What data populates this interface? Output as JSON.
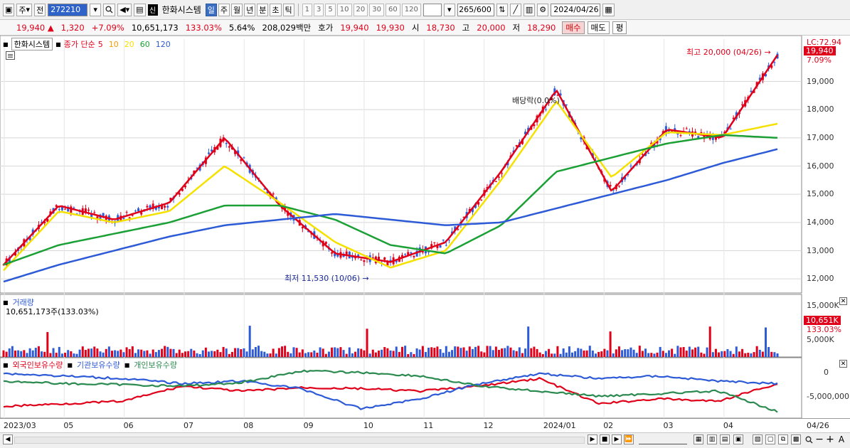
{
  "toolbar": {
    "period_select": "주",
    "prev_label": "전",
    "code": "272210",
    "badge": "신",
    "stock_name": "한화시스템",
    "periods": [
      "일",
      "주",
      "월",
      "년",
      "분",
      "초",
      "틱"
    ],
    "active_period": "일",
    "nums": [
      "1",
      "3",
      "5",
      "10",
      "20",
      "30",
      "60",
      "120"
    ],
    "count": "265",
    "count_total": "/600",
    "date": "2024/04/26"
  },
  "quote": {
    "price": "19,940",
    "change": "1,320",
    "change_pct": "+7.09%",
    "volume": "10,651,173",
    "vol_ratio": "133.03%",
    "turnover": "5.64%",
    "amount": "208,029백만",
    "bid_label": "호가",
    "ask_price": "19,940",
    "bid_price": "19,930",
    "open_label": "시",
    "open": "18,730",
    "high_label": "고",
    "high": "20,000",
    "low_label": "저",
    "low": "18,290",
    "buy": "매수",
    "sell": "매도",
    "eval": "평"
  },
  "legend": {
    "stock": "한화시스템",
    "ma_title": "종가 단순",
    "ma": [
      "5",
      "10",
      "20",
      "60",
      "120"
    ],
    "colors": [
      "#e0001a",
      "#ff9900",
      "#f5e100",
      "#1aa035",
      "#2d5ad6"
    ]
  },
  "annotations": {
    "high": "최고 20,000 (04/26)",
    "low": "최저 11,530 (10/06)",
    "dividend": "배당락(0.0%)"
  },
  "price_axis": {
    "lc": "LC:72.94",
    "last": "19,940",
    "last_pct": "7.09%",
    "ticks": [
      "19,000",
      "18,000",
      "17,000",
      "16,000",
      "15,000",
      "14,000",
      "13,000",
      "12,000"
    ]
  },
  "volume_panel": {
    "title": "거래량",
    "value": "10,651,173주(133.03%)",
    "ticks": [
      "15,000K",
      "5,000K"
    ],
    "last": "10,651K",
    "last_pct": "133.03%"
  },
  "holdings_panel": {
    "series": [
      "외국인보유수량",
      "기관보유수량",
      "개인보유수량"
    ],
    "colors": [
      "#e0001a",
      "#2d5ad6",
      "#2b8a4f"
    ],
    "ticks": [
      "0",
      "-5,000,000"
    ]
  },
  "x_axis": {
    "labels": [
      "2023/03",
      "05",
      "06",
      "07",
      "08",
      "09",
      "10",
      "11",
      "12",
      "2024/01",
      "02",
      "03",
      "04"
    ],
    "end": "04/26"
  },
  "chart_data": {
    "type": "line",
    "title": "한화시스템",
    "x": [
      "2023/03",
      "05",
      "06",
      "07",
      "08",
      "09",
      "10",
      "11",
      "12",
      "2024/01",
      "02",
      "03",
      "04",
      "04/26"
    ],
    "series": [
      {
        "name": "5",
        "values": [
          12500,
          14600,
          14100,
          14700,
          17000,
          14600,
          12900,
          12600,
          13300,
          15800,
          18700,
          15100,
          17300,
          17000,
          19940
        ]
      },
      {
        "name": "20",
        "values": [
          12300,
          14400,
          14000,
          14400,
          16000,
          14700,
          13300,
          12400,
          13000,
          15500,
          18300,
          15600,
          17200,
          17100,
          17500
        ]
      },
      {
        "name": "60",
        "values": [
          12500,
          13200,
          13600,
          14000,
          14600,
          14600,
          14100,
          13200,
          12900,
          13900,
          15800,
          16300,
          16800,
          17100,
          17000
        ]
      },
      {
        "name": "120",
        "values": [
          11900,
          12500,
          13000,
          13500,
          13900,
          14100,
          14300,
          14100,
          13900,
          14000,
          14500,
          15000,
          15500,
          16100,
          16600
        ]
      }
    ],
    "annotations": [
      "최고 20,000 (04/26)",
      "최저 11,530 (10/06)"
    ],
    "ylim": [
      11500,
      20500
    ],
    "grid": true
  }
}
